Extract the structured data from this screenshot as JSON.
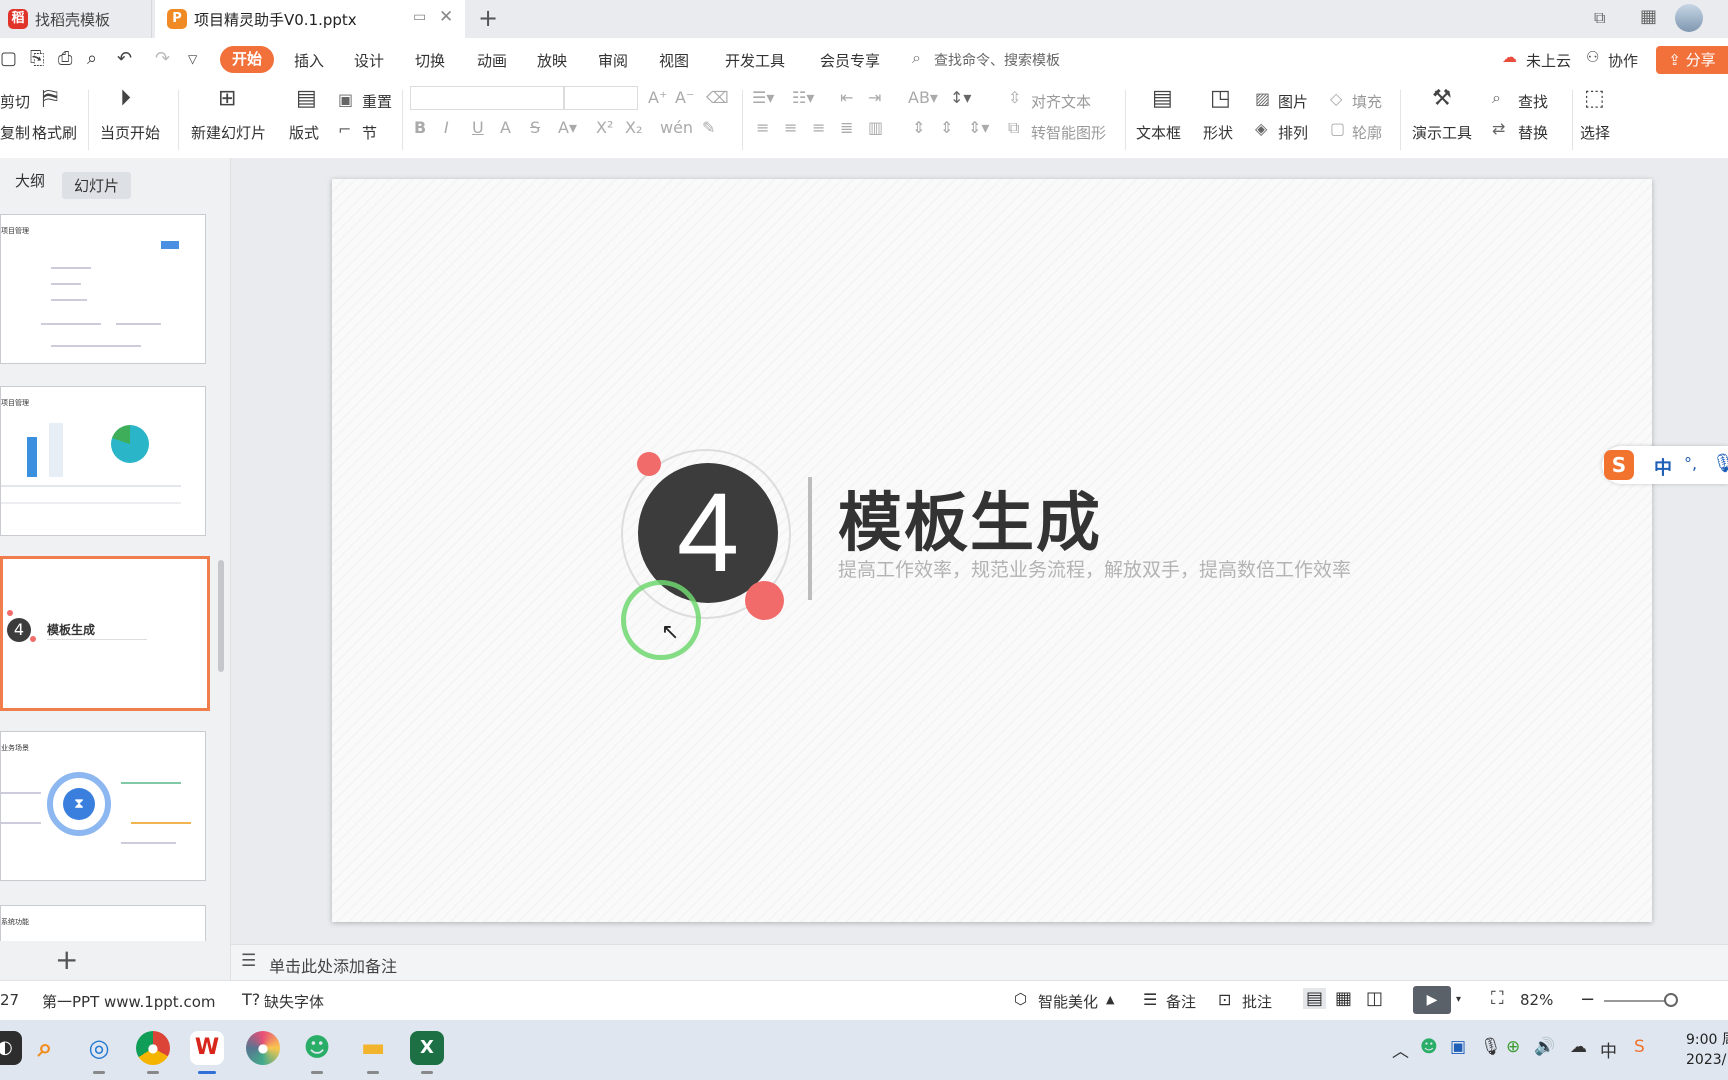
{
  "tabs": [
    {
      "label": "找稻壳模板",
      "active": false
    },
    {
      "label": "项目精灵助手V0.1.pptx",
      "active": true
    }
  ],
  "menu": {
    "items": [
      "开始",
      "插入",
      "设计",
      "切换",
      "动画",
      "放映",
      "审阅",
      "视图",
      "开发工具",
      "会员专享"
    ],
    "search_placeholder": "查找命令、搜索模板",
    "cloud": "未上云",
    "collab": "协作",
    "share": "分享"
  },
  "ribbon": {
    "cut": "剪切",
    "copy": "复制",
    "format_painter": "格式刷",
    "play_from_current": "当页开始",
    "new_slide": "新建幻灯片",
    "layout": "版式",
    "reset": "重置",
    "section": "节",
    "align_text": "对齐文本",
    "smartart": "转智能图形",
    "textbox": "文本框",
    "shape": "形状",
    "picture": "图片",
    "arrange": "排列",
    "fill": "填充",
    "outline": "轮廓",
    "present_tools": "演示工具",
    "find": "查找",
    "replace": "替换",
    "select": "选择"
  },
  "sidebar": {
    "outline_tab": "大纲",
    "slides_tab": "幻灯片",
    "thumb1_title": "项目管理",
    "thumb2_title": "项目管理",
    "thumb3_title": "模板生成",
    "thumb3_number": "4",
    "thumb4_title": "业务场景",
    "thumb5_title": "系统功能"
  },
  "slide": {
    "number": "4",
    "title": "模板生成",
    "subtitle": "提高工作效率，规范业务流程，解放双手，提高数倍工作效率"
  },
  "notes_placeholder": "单击此处添加备注",
  "ime": {
    "mode": "中",
    "punct": "°,"
  },
  "status": {
    "slide_count_fragment": "27",
    "theme": "第一PPT www.1ppt.com",
    "missing_font": "缺失字体",
    "beautify": "智能美化",
    "notes": "备注",
    "comment": "批注",
    "zoom": "82%"
  },
  "taskbar": {
    "time": "9:00 周",
    "date": "2023/"
  },
  "colors": {
    "accent": "#f2713b",
    "circle": "#3c3c3c",
    "dot": "#f26b6b",
    "green_ring": "#6fd76f"
  }
}
